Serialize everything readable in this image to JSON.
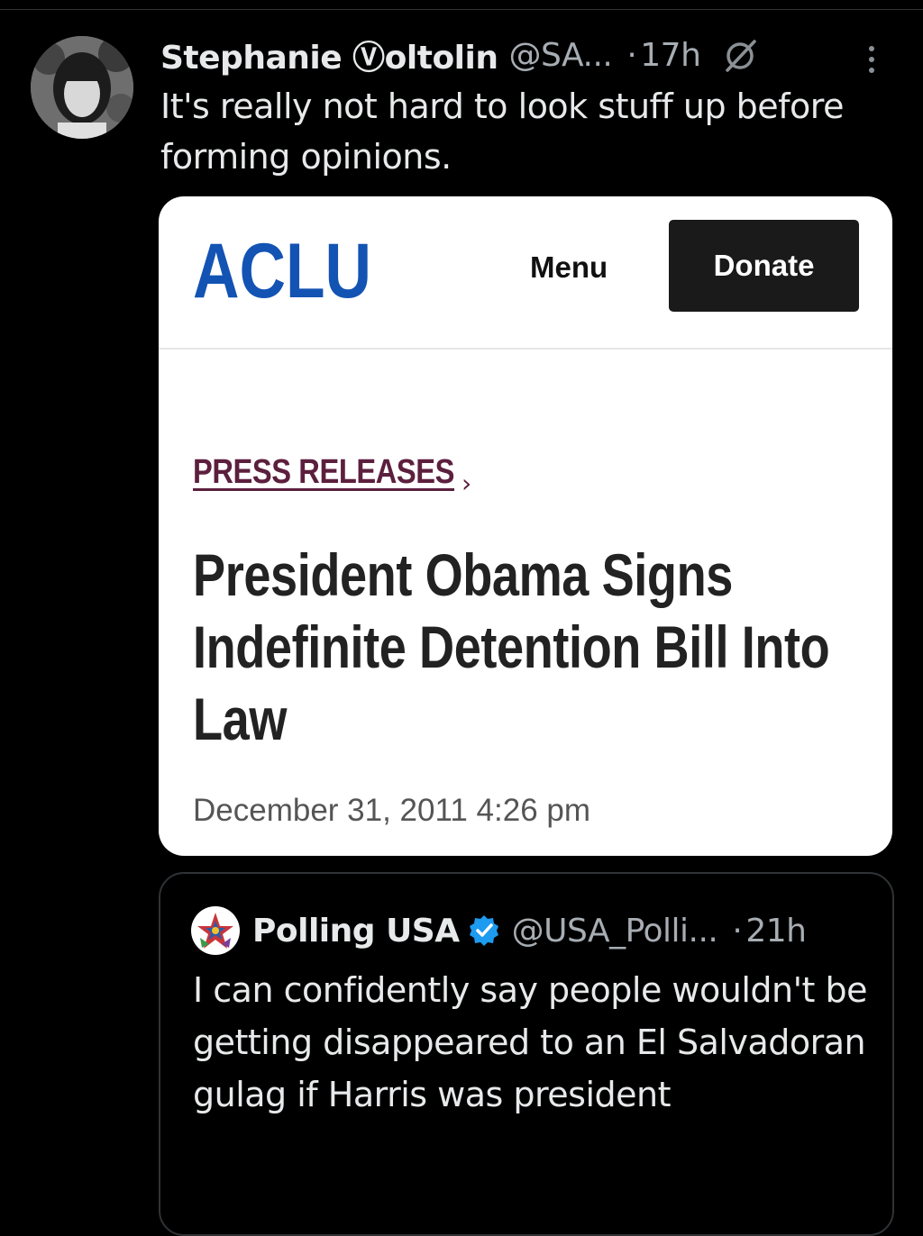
{
  "tweet": {
    "author_name": "Stephanie Ⓥoltolin",
    "handle": "@SA...",
    "separator": "·",
    "time": "17h",
    "text": "It's really not hard to look stuff up before forming opinions."
  },
  "card": {
    "logo_text": "ACLU",
    "menu_label": "Menu",
    "donate_label": "Donate",
    "section_label": "PRESS RELEASES",
    "chevron": "›",
    "headline": "President Obama Signs Indefinite Detention Bill Into Law",
    "date": "December 31, 2011 4:26 pm",
    "colors": {
      "logo": "#1353b3",
      "section": "#5c1f3d",
      "donate_bg": "#1a1a1a"
    }
  },
  "quoted": {
    "author_name": "Polling USA",
    "handle": "@USA_Polli...",
    "separator": "·",
    "time": "21h",
    "text": "I can confidently say people wouldn't be getting disappeared to an El Salvadoran gulag if Harris was president"
  },
  "icons": [
    "grok-icon",
    "more-icon",
    "verified-icon"
  ]
}
